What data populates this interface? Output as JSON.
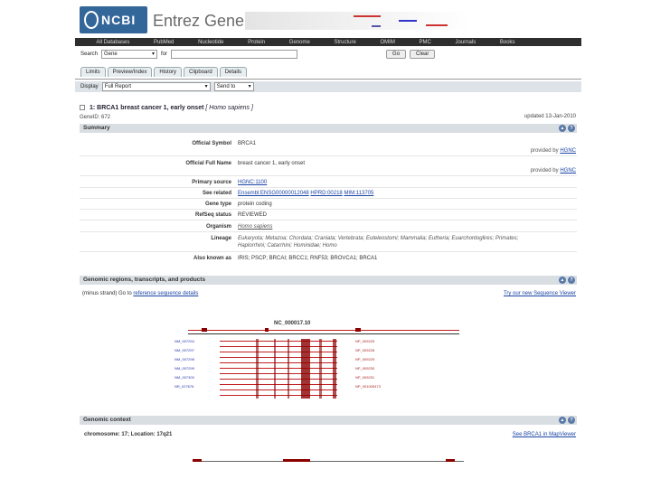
{
  "header": {
    "logo_text": "NCBI",
    "app_title": "Entrez Gene"
  },
  "topnav": [
    "All Databases",
    "PubMed",
    "Nucleotide",
    "Protein",
    "Genome",
    "Structure",
    "OMIM",
    "PMC",
    "Journals",
    "Books"
  ],
  "search": {
    "label": "Search",
    "db_value": "Gene",
    "for_label": "for",
    "query": "",
    "go_label": "Go",
    "clear_label": "Clear"
  },
  "tabs": [
    "Limits",
    "Preview/Index",
    "History",
    "Clipboard",
    "Details"
  ],
  "display": {
    "label": "Display",
    "format_value": "Full Report",
    "send_value": "Send to"
  },
  "gene": {
    "title_prefix": "1:",
    "title": "BRCA1 breast cancer 1, early onset",
    "species": "[ Homo sapiens ]",
    "gene_id": "GeneID: 672",
    "updated": "updated 13-Jan-2010"
  },
  "summary": {
    "heading": "Summary",
    "official_symbol_key": "Official Symbol",
    "official_symbol_val": "BRCA1",
    "provided_by_1": "provided by",
    "hgnc_1": "HGNC",
    "official_name_key": "Official Full Name",
    "official_name_val": "breast cancer 1, early onset",
    "provided_by_2": "provided by",
    "hgnc_2": "HGNC",
    "primary_source_key": "Primary source",
    "primary_source_val": "HGNC:1100",
    "see_related_key": "See related",
    "see_related_1": "Ensembl:ENSG00000012048",
    "see_related_2": "HPRD:00218",
    "see_related_3": "MIM:113705",
    "gene_type_key": "Gene type",
    "gene_type_val": "protein coding",
    "refseq_key": "RefSeq status",
    "refseq_val": "REVIEWED",
    "organism_key": "Organism",
    "organism_val": "Homo sapiens",
    "lineage_key": "Lineage",
    "lineage_val_1": "Eukaryota; Metazoa; Chordata; Craniata; Vertebrata; Euteleostomi; Mammalia; Eutheria; Euarchontoglires; Primates;",
    "lineage_val_2": "Haplorrhini; Catarrhini; Hominidae; Homo",
    "aka_key": "Also known as",
    "aka_val": "IRIS; PSCP; BRCAI; BRCC1; RNF53; BROVCA1; BRCA1"
  },
  "genomic_regions": {
    "heading": "Genomic regions, transcripts, and products",
    "strand_note": "(minus strand) Go to",
    "ref_link": "reference sequence details",
    "viewer_link": "Try our new Sequence Viewer",
    "accession": "NC_000017.10"
  },
  "genomic_context": {
    "heading": "Genomic context",
    "location": "chromosome: 17; Location: 17q21",
    "mapviewer_link": "See BRCA1 in MapViewer"
  },
  "colors": {
    "nav_bg": "#2e2e2e",
    "section_bg": "#d9dee3",
    "link": "#1b44a3",
    "exon": "#8b0000",
    "logo_bg": "#336699"
  }
}
